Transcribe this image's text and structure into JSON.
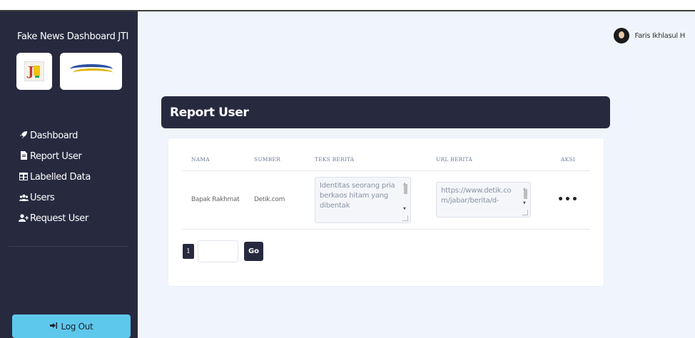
{
  "sidebar": {
    "brand": "Fake News Dashboard JTI",
    "items": [
      {
        "icon": "rocket-icon",
        "glyph": "🚀",
        "label": "Dashboard"
      },
      {
        "icon": "file-icon",
        "glyph": "📄",
        "label": "Report User"
      },
      {
        "icon": "table-icon",
        "glyph": "▦",
        "label": "Labelled Data"
      },
      {
        "icon": "users-icon",
        "glyph": "👥",
        "label": "Users"
      },
      {
        "icon": "user-plus-icon",
        "glyph": "👤",
        "label": "Request User"
      }
    ],
    "logout": {
      "icon": "sign-out-icon",
      "glyph": "⇥",
      "label": "Log Out"
    }
  },
  "topbar": {
    "user_name": "Faris Ikhlasul H"
  },
  "page": {
    "title": "Report User"
  },
  "table": {
    "headers": [
      "NAMA",
      "SUMBER",
      "TEKS BERITA",
      "URL BERITA",
      "AKSI"
    ],
    "rows": [
      {
        "nama": "Bapak Rakhmat",
        "sumber": "Detik.com",
        "teks": "Identitas seorang pria berkaos hitam yang dibentak",
        "url": "https://www.detik.com/jabar/berita/d-",
        "aksi": "•••"
      }
    ]
  },
  "pagination": {
    "current_page": "1",
    "go_label": "Go",
    "input_value": ""
  },
  "colors": {
    "sidebar_bg": "#272a3f",
    "main_bg": "#f0f5fd",
    "logout_bg": "#5ec8ec"
  }
}
